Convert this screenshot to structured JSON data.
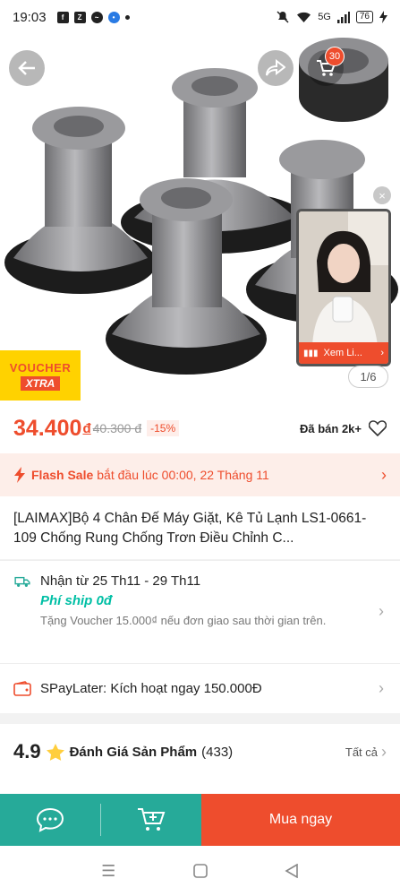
{
  "status_bar": {
    "time": "19:03",
    "network": "5G",
    "battery": "76"
  },
  "hero": {
    "cart_count": "30",
    "voucher_top": "VOUCHER",
    "voucher_bottom": "XTRA",
    "live_label": "Xem Li...",
    "image_counter": "1/6"
  },
  "price": {
    "current": "34.400",
    "currency": "đ",
    "original": "40.300 đ",
    "discount": "-15%",
    "sold": "Đã bán 2k+"
  },
  "flash_sale": {
    "label": "Flash Sale",
    "text": "bắt đầu lúc 00:00, 22 Tháng 11"
  },
  "product_title": "[LAIMAX]Bộ 4 Chân Đế Máy Giặt, Kê Tủ Lạnh LS1-0661-109 Chống Rung Chống Trơn Điều Chỉnh C...",
  "shipping": {
    "date": "Nhận từ 25 Th11 - 29 Th11",
    "fee": "Phí ship 0đ",
    "voucher": "Tặng Voucher 15.000₫ nếu đơn giao sau thời gian trên."
  },
  "spaylater": "SPayLater: Kích hoạt ngay 150.000Đ",
  "rating": {
    "score": "4.9",
    "label": "Đánh Giá Sản Phẩm",
    "count": "(433)",
    "see_all": "Tất cả"
  },
  "actions": {
    "buy_now": "Mua ngay"
  },
  "colors": {
    "primary": "#ee4d2d",
    "teal": "#26aa99",
    "free_ship": "#00bfa5",
    "voucher_bg": "#ffd200"
  }
}
